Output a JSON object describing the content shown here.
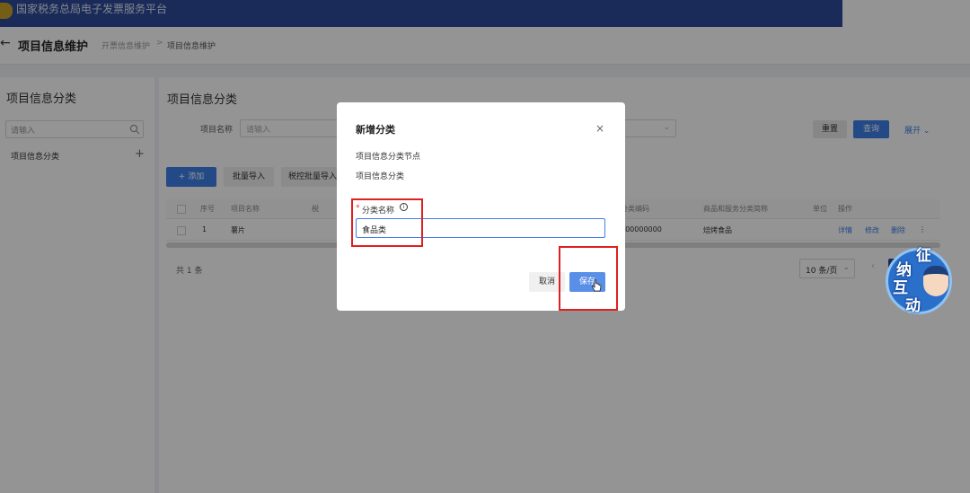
{
  "topbar": {
    "brand": "国家税务总局电子发票服务平台"
  },
  "breadcrumb": {
    "back_icon": "←",
    "page_title": "项目信息维护",
    "items": [
      "开票信息维护",
      "项目信息维护"
    ],
    "separator": ">"
  },
  "sidebar": {
    "title": "项目信息分类",
    "search_placeholder": "请输入",
    "tree_items": [
      {
        "label": "项目信息分类"
      }
    ],
    "add_icon": "+"
  },
  "main": {
    "title": "项目信息分类",
    "filter": {
      "label": "项目名称",
      "placeholder": "请输入"
    },
    "buttons": {
      "reset": "重置",
      "query": "查询",
      "expand": "展开"
    },
    "toolbar": {
      "add": "+ 添加",
      "batch_import": "批量导入",
      "tax_batch_import": "税控批量导入"
    },
    "table": {
      "headers": [
        "序号",
        "项目名称",
        "税",
        "分类编码",
        "商品和服务分类简称",
        "单位",
        "操作"
      ],
      "rows": [
        {
          "index": "1",
          "name": "薯片",
          "code": "000000000",
          "short_name": "焙烤食品",
          "actions": [
            "详情",
            "修改",
            "删除"
          ],
          "more": "⋮"
        }
      ]
    },
    "pagination": {
      "total": "共 1 条",
      "page_size": "10 条/页",
      "prev": "‹"
    }
  },
  "modal": {
    "title": "新增分类",
    "close": "×",
    "node_label": "项目信息分类节点",
    "node_value": "项目信息分类",
    "field_required": "*",
    "field_label": "分类名称",
    "info_icon": "i",
    "field_value": "食品类",
    "cancel": "取消",
    "save": "保存"
  },
  "badge": {
    "chars": [
      "征",
      "纳",
      "互",
      "动"
    ]
  },
  "colors": {
    "primary": "#3f7ee8",
    "header": "#2e4a9a",
    "highlight": "#e02020"
  }
}
